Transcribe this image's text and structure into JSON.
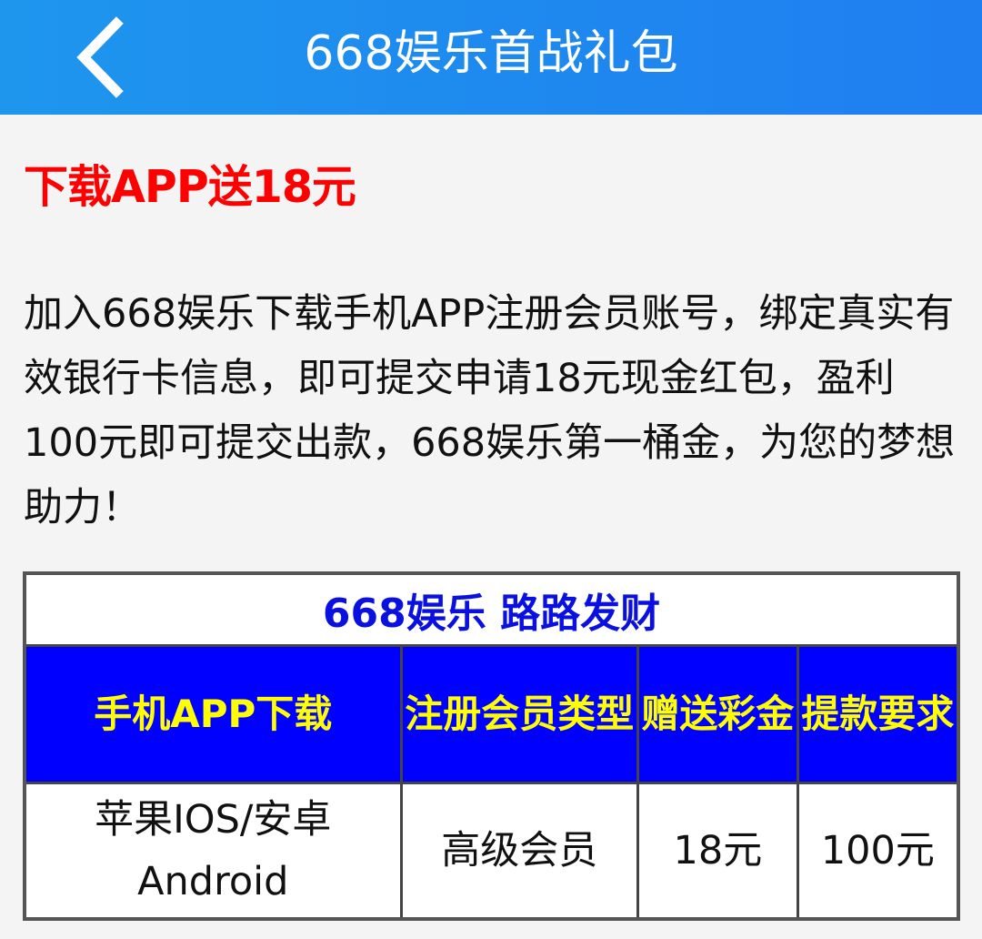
{
  "header": {
    "title": "668娱乐首战礼包"
  },
  "promo": {
    "title": "下载APP送18元",
    "body": "加入668娱乐下载手机APP注册会员账号，绑定真实有效银行卡信息，即可提交申请18元现金红包，盈利100元即可提交出款，668娱乐第一桶金，为您的梦想助力！"
  },
  "table": {
    "title": "668娱乐 路路发财",
    "headers": [
      "手机APP下载",
      "注册会员类型",
      "赠送彩金",
      "提款要求"
    ],
    "rows": [
      [
        "苹果IOS/安卓Android",
        "高级会员",
        "18元",
        "100元"
      ]
    ]
  },
  "colors": {
    "header_bg": "#1f8af0",
    "promo_title": "#ff0000",
    "table_head_bg": "#0000ff",
    "table_head_text": "#ffff00",
    "table_title_text": "#0a10e0"
  },
  "icons": {
    "back": "chevron-left-icon"
  }
}
